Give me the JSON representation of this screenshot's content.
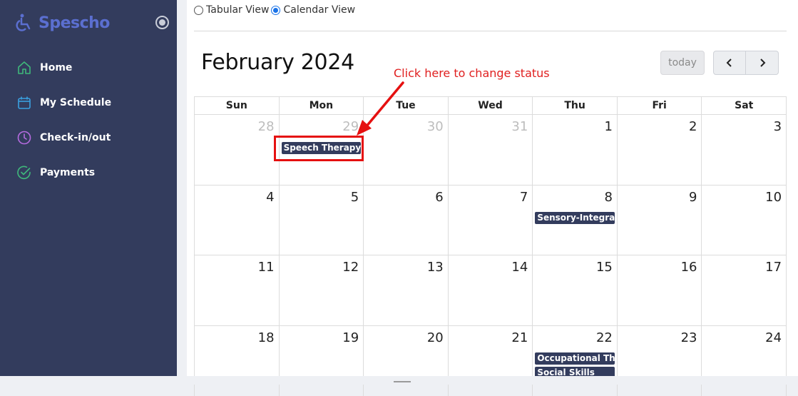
{
  "app": {
    "name": "Spescho"
  },
  "sidebar": {
    "items": [
      {
        "label": "Home",
        "icon": "home-icon",
        "color": "#3fb87b"
      },
      {
        "label": "My Schedule",
        "icon": "calendar-icon",
        "color": "#3aa0e0"
      },
      {
        "label": "Check-in/out",
        "icon": "clock-icon",
        "color": "#b56be0"
      },
      {
        "label": "Payments",
        "icon": "check-circle-icon",
        "color": "#3fb87b"
      }
    ]
  },
  "view_toggle": {
    "tabular_label": "Tabular View",
    "calendar_label": "Calendar View",
    "selected": "Calendar View"
  },
  "calendar": {
    "title": "February 2024",
    "today_label": "today",
    "prev_label": "‹",
    "next_label": "›",
    "weekdays": [
      "Sun",
      "Mon",
      "Tue",
      "Wed",
      "Thu",
      "Fri",
      "Sat"
    ],
    "weeks": [
      [
        "28",
        "29",
        "30",
        "31",
        "1",
        "2",
        "3"
      ],
      [
        "4",
        "5",
        "6",
        "7",
        "8",
        "9",
        "10"
      ],
      [
        "11",
        "12",
        "13",
        "14",
        "15",
        "16",
        "17"
      ],
      [
        "18",
        "19",
        "20",
        "21",
        "22",
        "23",
        "24"
      ]
    ],
    "events": {
      "speech_therapy": "Speech Therapy",
      "sensory_integration": "Sensory-Integration",
      "occupational_therapy": "Occupational Therapy",
      "social_skills": "Social Skills"
    }
  },
  "annotation": {
    "text": "Click here to change status",
    "color": "#e02020"
  }
}
